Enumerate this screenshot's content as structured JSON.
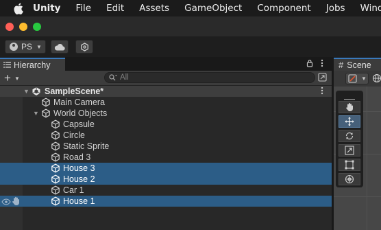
{
  "menubar": {
    "app": "Unity",
    "items": [
      "File",
      "Edit",
      "Assets",
      "GameObject",
      "Component",
      "Jobs",
      "Window"
    ]
  },
  "toolbar": {
    "account_label": "PS"
  },
  "hierarchy": {
    "tab_label": "Hierarchy",
    "search_placeholder": "All",
    "scene_name": "SampleScene*",
    "rows": [
      {
        "label": "Main Camera",
        "depth": 1,
        "selected": false
      },
      {
        "label": "World Objects",
        "depth": 1,
        "selected": false,
        "expanded": true
      },
      {
        "label": "Capsule",
        "depth": 2,
        "selected": false
      },
      {
        "label": "Circle",
        "depth": 2,
        "selected": false
      },
      {
        "label": "Static Sprite",
        "depth": 2,
        "selected": false
      },
      {
        "label": "Road 3",
        "depth": 2,
        "selected": false
      },
      {
        "label": "House 3",
        "depth": 2,
        "selected": true
      },
      {
        "label": "House 2",
        "depth": 2,
        "selected": true
      },
      {
        "label": "Car 1",
        "depth": 2,
        "selected": false
      },
      {
        "label": "House 1",
        "depth": 2,
        "selected": true
      }
    ]
  },
  "scene": {
    "tab_label": "Scene",
    "tools": [
      "hand-tool",
      "move-tool",
      "rotate-tool",
      "scale-tool",
      "rect-tool",
      "transform-tool"
    ],
    "active_tool": "move-tool"
  },
  "colors": {
    "selection": "#2c5d87",
    "tab_accent": "#3a79bb"
  }
}
